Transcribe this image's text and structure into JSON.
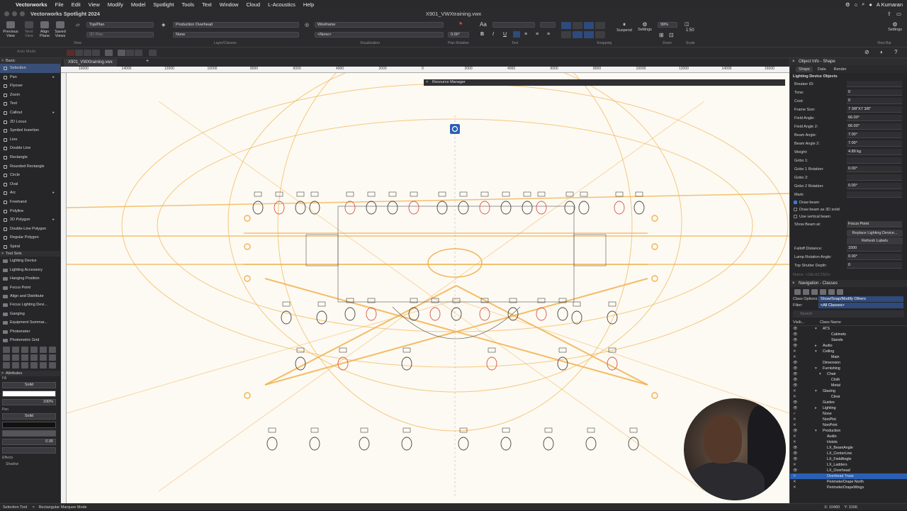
{
  "menubar": {
    "app": "Vectorworks",
    "items": [
      "File",
      "Edit",
      "View",
      "Modify",
      "Model",
      "Spotlight",
      "Tools",
      "Text",
      "Window",
      "Cloud",
      "L-Acoustics",
      "Help"
    ],
    "user": "A Kumaran"
  },
  "titlebar": {
    "app_title": "Vectorworks Spotlight 2024",
    "doc_title": "X901_VWXtraining.vwx"
  },
  "toolbar": {
    "previous_view": "Previous View",
    "next_view": "Next View",
    "align_plane": "Align Plane",
    "saved_views": "Saved Views",
    "view_mode": "Top/Plan",
    "plane": "2D Plan",
    "layer": "Production Overhead",
    "class": "None",
    "render_mode": "Wireframe",
    "projection": "<None>",
    "plan_rotation": "0.00°",
    "suspend": "Suspend",
    "settings": "Settings",
    "zoom": "99%",
    "scale": "1:50",
    "settings_right": "Settings",
    "sections": [
      "View",
      "Layer/Classes",
      "Visualization",
      "Plan Rotation",
      "Text",
      "Snapping",
      "Zoom",
      "Scale",
      "View Bar"
    ]
  },
  "subtool": {
    "mode_label": "Auto Mode"
  },
  "tools": {
    "header": "Basic",
    "items": [
      {
        "label": "Selection",
        "arrow": false
      },
      {
        "label": "Pan",
        "arrow": true
      },
      {
        "label": "Flyover",
        "arrow": false
      },
      {
        "label": "Zoom",
        "arrow": false
      },
      {
        "label": "Text",
        "arrow": false
      },
      {
        "label": "Callout",
        "arrow": true
      },
      {
        "label": "2D Locus",
        "arrow": false
      },
      {
        "label": "Symbol Insertion",
        "arrow": false
      },
      {
        "label": "Line",
        "arrow": false
      },
      {
        "label": "Double Line",
        "arrow": false
      },
      {
        "label": "Rectangle",
        "arrow": false
      },
      {
        "label": "Rounded Rectangle",
        "arrow": false
      },
      {
        "label": "Circle",
        "arrow": false
      },
      {
        "label": "Oval",
        "arrow": false
      },
      {
        "label": "Arc",
        "arrow": true
      },
      {
        "label": "Freehand",
        "arrow": false
      },
      {
        "label": "Polyline",
        "arrow": false
      },
      {
        "label": "2D Polygon",
        "arrow": true
      },
      {
        "label": "Double-Line Polygon",
        "arrow": false
      },
      {
        "label": "Regular Polygon",
        "arrow": false
      },
      {
        "label": "Spiral",
        "arrow": false
      }
    ]
  },
  "toolsets": {
    "header": "Tool Sets",
    "items": [
      "Lighting Device",
      "Lighting Accessory",
      "Hanging Position",
      "Focus Point",
      "Align and Distribute",
      "Focus Lighting Devi...",
      "Ganging",
      "Equipment Summar...",
      "Photometer",
      "Photometric Grid"
    ]
  },
  "attributes": {
    "header": "Attributes",
    "fill_label": "Fill",
    "fill_value": "Solid",
    "opacity": "100%",
    "pen_label": "Pen",
    "pen_value": "Solid",
    "thickness": "0.05",
    "effects_label": "Effects",
    "shadow_label": "Shadow"
  },
  "document": {
    "tab": "X901_VWXtraining.vwx",
    "ruler_labels": [
      "16000",
      "14000",
      "12000",
      "10000",
      "8000",
      "6000",
      "4000",
      "2000",
      "0",
      "2000",
      "4000",
      "6000",
      "8000",
      "10000",
      "12000",
      "14000",
      "16000"
    ],
    "floating_palette": "Resource Manager"
  },
  "object_info": {
    "header": "Object Info - Shape",
    "tabs": [
      "Shape",
      "Data",
      "Render"
    ],
    "section": "Lighting Device Objects",
    "properties": [
      {
        "label": "Breaker ID:",
        "value": ""
      },
      {
        "label": "Time:",
        "value": "0"
      },
      {
        "label": "Cost:",
        "value": "0"
      },
      {
        "label": "Frame Size:",
        "value": "7 3/8\"X7 3/8\""
      },
      {
        "label": "Field Angle:",
        "value": "66.00°"
      },
      {
        "label": "Field Angle 2:",
        "value": "66.00°"
      },
      {
        "label": "Beam Angle:",
        "value": "7.00°"
      },
      {
        "label": "Beam Angle 2:",
        "value": "7.00°"
      },
      {
        "label": "Weight:",
        "value": "4.89 kg"
      },
      {
        "label": "Gobo 1:",
        "value": ""
      },
      {
        "label": "Gobo 1 Rotation:",
        "value": "0.00°"
      },
      {
        "label": "Gobo 2:",
        "value": ""
      },
      {
        "label": "Gobo 2 Rotation:",
        "value": "0.00°"
      },
      {
        "label": "Mark:",
        "value": ""
      }
    ],
    "checks": [
      {
        "label": "Draw beam",
        "checked": true
      },
      {
        "label": "Draw beam as 3D solid",
        "checked": false
      },
      {
        "label": "Use vertical beam",
        "checked": false
      }
    ],
    "show_beam_label": "Show Beam at:",
    "show_beam_value": "Focus Point",
    "replace_button": "Replace Lighting Device...",
    "refresh_button": "Refresh Labels",
    "extra": [
      {
        "label": "Falloff Distance:",
        "value": "1500"
      },
      {
        "label": "Lamp Rotation Angle:",
        "value": "0.00°"
      },
      {
        "label": "Top Shutter Depth:",
        "value": "0"
      }
    ],
    "name_label": "Name: <SELECTED>"
  },
  "navigation": {
    "header": "Navigation - Classes",
    "class_options_label": "Class Options:",
    "class_options_value": "Show/Snap/Modify Others",
    "filter_label": "Filter:",
    "filter_value": "<All Classes>",
    "search_placeholder": "Search",
    "col_visibility": "Visib...",
    "col_name": "Class Name",
    "classes": [
      {
        "name": "ATS",
        "indent": 0,
        "arrow": "▾",
        "vis": "👁"
      },
      {
        "name": "Cabinets",
        "indent": 2,
        "arrow": "",
        "vis": "👁"
      },
      {
        "name": "Stands",
        "indent": 2,
        "arrow": "",
        "vis": "👁"
      },
      {
        "name": "Audio",
        "indent": 0,
        "arrow": "▸",
        "vis": "👁"
      },
      {
        "name": "Ceiling",
        "indent": 0,
        "arrow": "▾",
        "vis": "✕"
      },
      {
        "name": "Main",
        "indent": 2,
        "arrow": "",
        "vis": "✕"
      },
      {
        "name": "Dimension",
        "indent": 0,
        "arrow": "",
        "vis": "👁"
      },
      {
        "name": "Furnishing",
        "indent": 0,
        "arrow": "▾",
        "vis": "👁"
      },
      {
        "name": "Chair",
        "indent": 1,
        "arrow": "▾",
        "vis": "👁"
      },
      {
        "name": "Cloth",
        "indent": 2,
        "arrow": "",
        "vis": "👁"
      },
      {
        "name": "Metal",
        "indent": 2,
        "arrow": "",
        "vis": "👁"
      },
      {
        "name": "Glazing",
        "indent": 0,
        "arrow": "▾",
        "vis": "✕"
      },
      {
        "name": "Clear",
        "indent": 2,
        "arrow": "",
        "vis": "✕"
      },
      {
        "name": "Guides",
        "indent": 0,
        "arrow": "",
        "vis": "👁"
      },
      {
        "name": "Lighting",
        "indent": 0,
        "arrow": "▸",
        "vis": "👁"
      },
      {
        "name": "None",
        "indent": 0,
        "arrow": "",
        "vis": "✓"
      },
      {
        "name": "NonPlot",
        "indent": 0,
        "arrow": "",
        "vis": "✕"
      },
      {
        "name": "NonPrint",
        "indent": 0,
        "arrow": "",
        "vis": "✕"
      },
      {
        "name": "Production",
        "indent": 0,
        "arrow": "▾",
        "vis": "👁"
      },
      {
        "name": "Audio",
        "indent": 1,
        "arrow": "",
        "vis": "✕"
      },
      {
        "name": "Hoists",
        "indent": 1,
        "arrow": "",
        "vis": "✕"
      },
      {
        "name": "LX_BeamAngle",
        "indent": 1,
        "arrow": "",
        "vis": "👁"
      },
      {
        "name": "LX_CenterLine",
        "indent": 1,
        "arrow": "",
        "vis": "👁"
      },
      {
        "name": "LX_FieldAngle",
        "indent": 1,
        "arrow": "",
        "vis": "👁"
      },
      {
        "name": "LX_Ladders",
        "indent": 1,
        "arrow": "",
        "vis": "✕"
      },
      {
        "name": "LX_Overhead",
        "indent": 1,
        "arrow": "",
        "vis": "👁"
      },
      {
        "name": "Overhead Truss",
        "indent": 1,
        "arrow": "",
        "vis": "✕",
        "selected": true
      },
      {
        "name": "PerimeterDrape North",
        "indent": 1,
        "arrow": "",
        "vis": "✕"
      },
      {
        "name": "PerimeterDrapeWings",
        "indent": 1,
        "arrow": "",
        "vis": "✕"
      }
    ]
  },
  "statusbar": {
    "left": "Selection Tool",
    "mode": "Rectangular Marquee Mode",
    "x": "X: 10460",
    "y": "Y: 3166"
  },
  "colors": {
    "beam": "#f2b24f",
    "fixture_red": "#d9534f",
    "select_blue": "#2b5fb4"
  }
}
